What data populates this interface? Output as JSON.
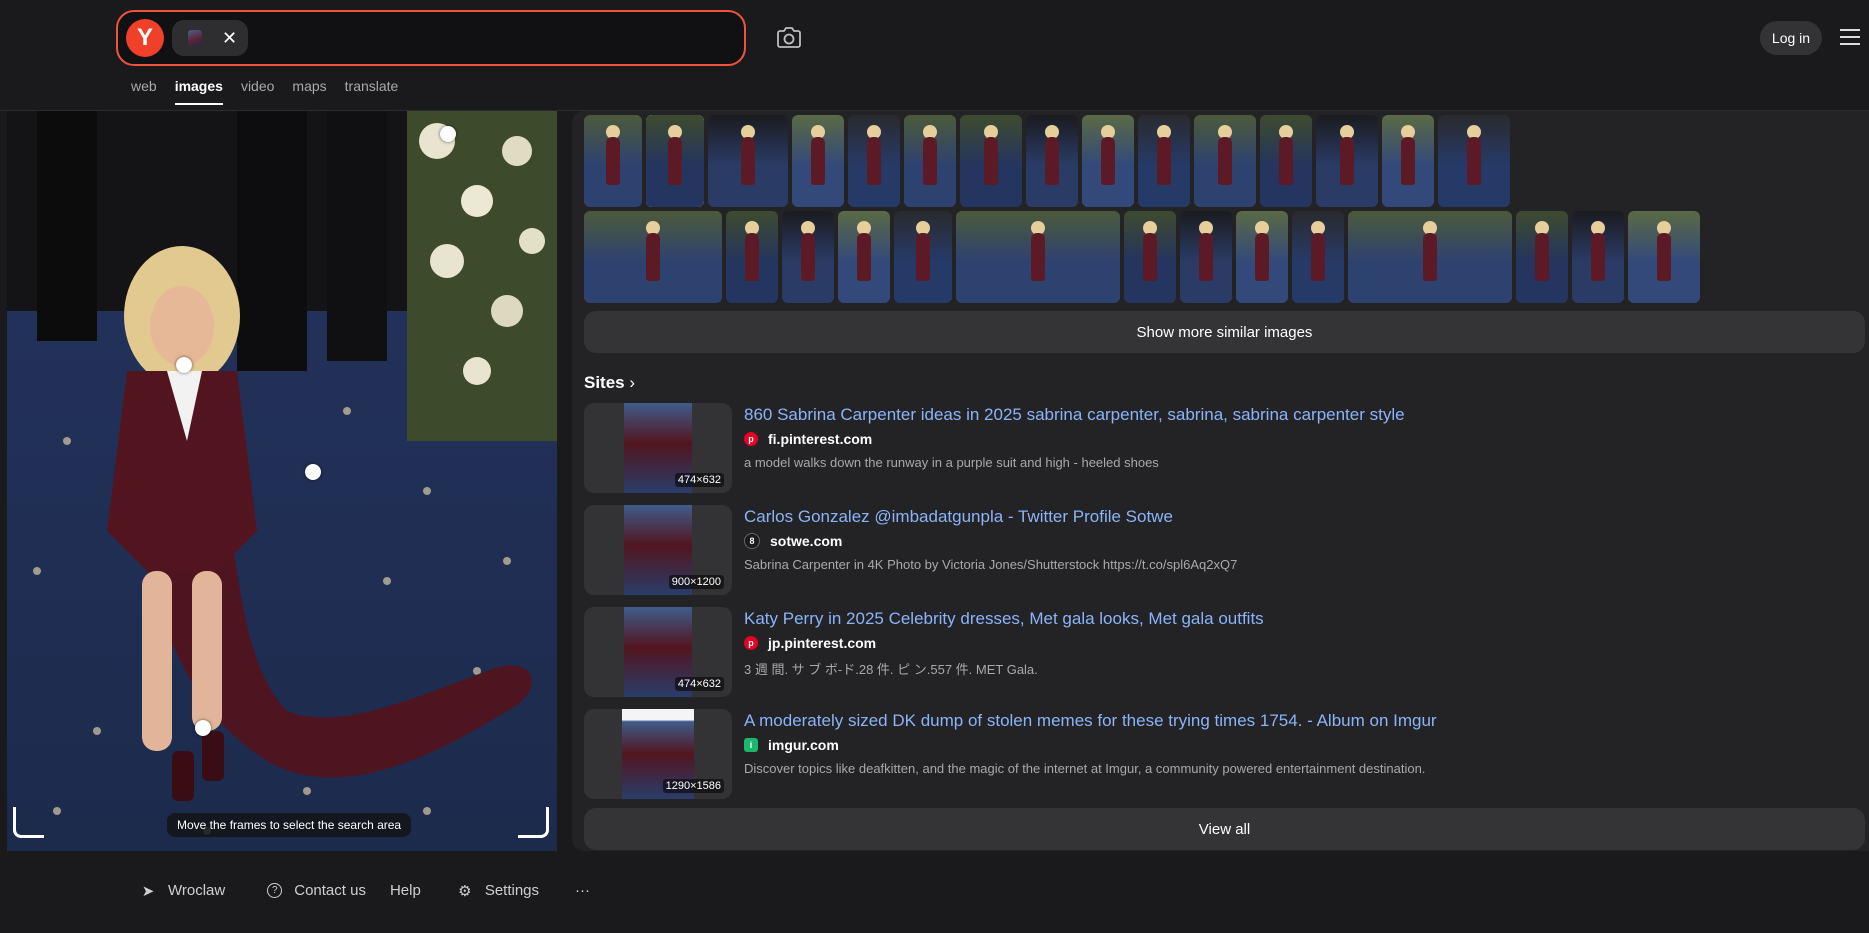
{
  "header": {
    "logo_letter": "Y",
    "clear_glyph": "✕",
    "login_label": "Log in",
    "tabs": [
      "web",
      "images",
      "video",
      "maps",
      "translate"
    ],
    "active_tab": "images"
  },
  "preview": {
    "hint": "Move the frames to select the search area"
  },
  "similar": {
    "show_more_label": "Show more similar images"
  },
  "sites": {
    "title": "Sites",
    "items": [
      {
        "title": "860 Sabrina Carpenter ideas in 2025 sabrina carpenter, sabrina, sabrina carpenter style",
        "domain": "fi.pinterest.com",
        "favicon": "pinterest-icon",
        "description": "a model walks down the runway in a purple suit and high - heeled shoes",
        "size": "474×632"
      },
      {
        "title": "Carlos Gonzalez @imbadatgunpla - Twitter Profile Sotwe",
        "domain": "sotwe.com",
        "favicon": "sotwe-icon",
        "description": "Sabrina Carpenter in 4K Photo by Victoria Jones/Shutterstock https://t.co/spl6Aq2xQ7",
        "size": "900×1200"
      },
      {
        "title": "Katy Perry in 2025 Celebrity dresses, Met gala looks, Met gala outfits",
        "domain": "jp.pinterest.com",
        "favicon": "pinterest-icon",
        "description": "3 週 間. サ ブ ボ-ド.28 件. ピ ン.557 件. MET Gala.",
        "size": "474×632"
      },
      {
        "title": "A moderately sized DK dump of stolen memes for these trying times 1754. - Album on Imgur",
        "domain": "imgur.com",
        "favicon": "imgur-icon",
        "description": "Discover topics like deafkitten, and the magic of the internet at Imgur, a community powered entertainment destination.",
        "size": "1290×1586"
      }
    ],
    "view_all_label": "View all"
  },
  "footer": {
    "location": "Wroclaw",
    "contact": "Contact us",
    "help": "Help",
    "settings": "Settings",
    "more": "···"
  },
  "colors": {
    "background": "#1a1a1c",
    "accent": "#f0543c",
    "link": "#8ab4f8",
    "panel": "#232326"
  }
}
